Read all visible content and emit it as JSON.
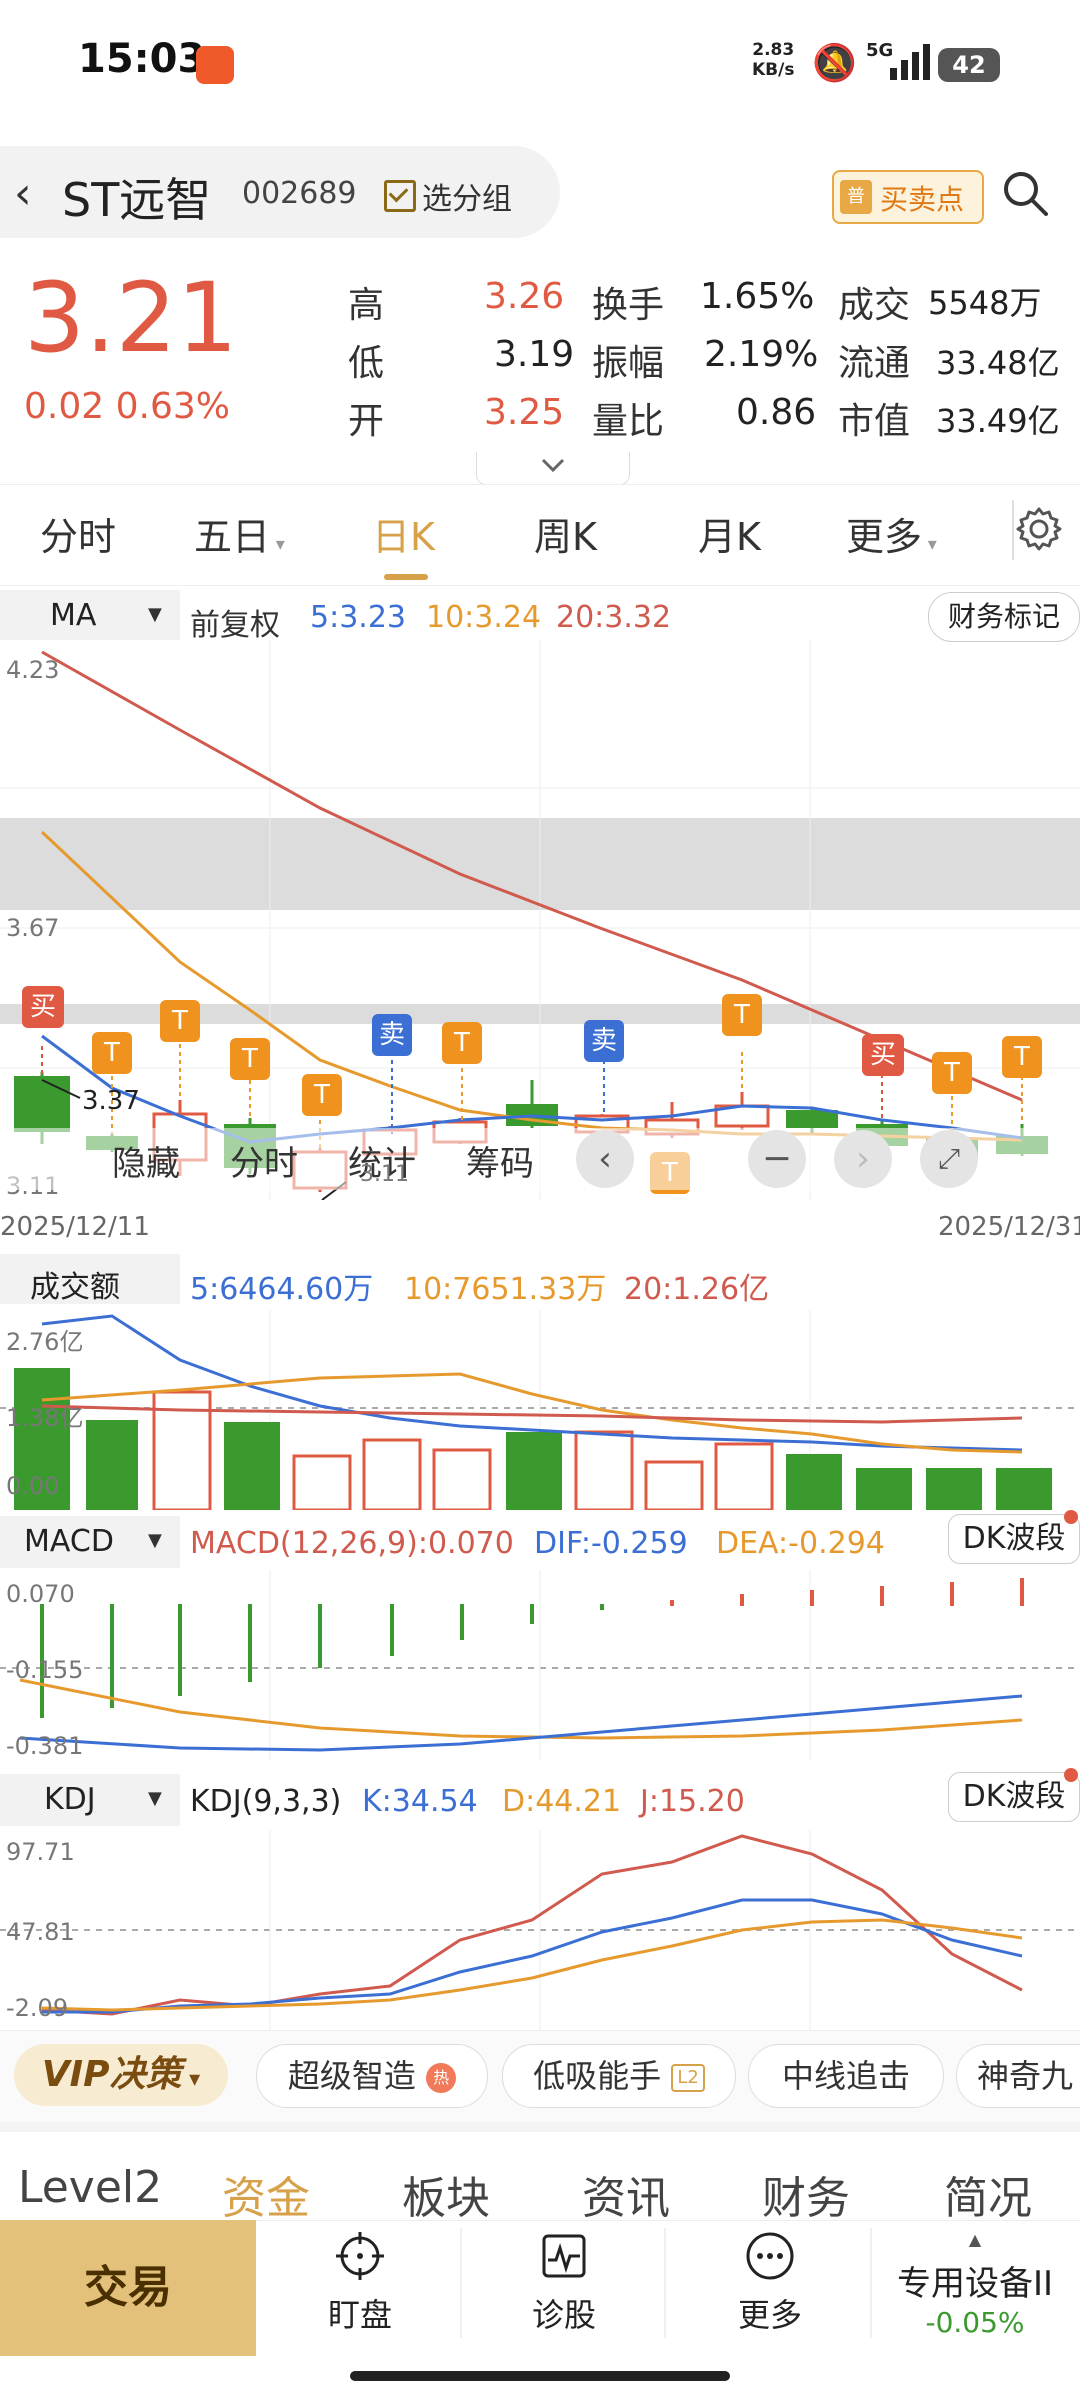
{
  "status": {
    "time": "15:03",
    "net_rate": "2.83",
    "net_unit": "KB/s",
    "network": "5G",
    "battery": "42"
  },
  "stock": {
    "name": "ST远智",
    "code": "002689",
    "watch_label": "选分组",
    "buysell_badge": "普",
    "buysell_label": "买卖点"
  },
  "quote": {
    "price": "3.21",
    "change": "0.02",
    "change_pct": "0.63%",
    "rows": [
      {
        "l1": "高",
        "v1": "3.26",
        "l2": "换手",
        "v2": "1.65%",
        "l3": "成交",
        "v3": "5548万"
      },
      {
        "l1": "低",
        "v1": "3.19",
        "l2": "振幅",
        "v2": "2.19%",
        "l3": "流通",
        "v3": "33.48亿"
      },
      {
        "l1": "开",
        "v1": "3.25",
        "l2": "量比",
        "v2": "0.86",
        "l3": "市值",
        "v3": "33.49亿"
      }
    ]
  },
  "tabs": [
    "分时",
    "五日",
    "日K",
    "周K",
    "月K",
    "更多"
  ],
  "ma": {
    "selector": "MA",
    "adjust": "前复权",
    "ma5": "5:3.23",
    "ma10": "10:3.24",
    "ma20": "20:3.32",
    "fin_button": "财务标记",
    "axis_top": "4.23",
    "axis_mid": "3.67",
    "axis_bot": "3.11",
    "low_marker": "3.37",
    "date_start": "2025/12/11",
    "date_end": "2025/12/31"
  },
  "overlay": {
    "hide": "隐藏",
    "intraday": "分时",
    "stats": "统计",
    "chips": "筹码",
    "mini_label": "3.11"
  },
  "volume": {
    "title": "成交额",
    "ma5": "5:6464.60万",
    "ma10": "10:7651.33万",
    "ma20": "20:1.26亿",
    "axis_top": "2.76亿",
    "axis_mid": "1.38亿",
    "axis_bot": "0.00"
  },
  "macd": {
    "selector": "MACD",
    "title": "MACD(12,26,9):0.070",
    "dif": "DIF:-0.259",
    "dea": "DEA:-0.294",
    "button": "DK波段",
    "axis_top": "0.070",
    "axis_mid": "-0.155",
    "axis_bot": "-0.381"
  },
  "kdj": {
    "selector": "KDJ",
    "title": "KDJ(9,3,3)",
    "k": "K:34.54",
    "d": "D:44.21",
    "j": "J:15.20",
    "button": "DK波段",
    "axis_top": "97.71",
    "axis_mid": "47.81",
    "axis_bot": "-2.09"
  },
  "features": {
    "vip": "VIP决策",
    "items": [
      "超级智造",
      "低吸能手",
      "中线追击",
      "神奇九"
    ],
    "hot_badge": "热",
    "l2_badge": "L2"
  },
  "info_tabs": [
    "Level2",
    "资金",
    "板块",
    "资讯",
    "财务",
    "简况"
  ],
  "bottom": {
    "trade": "交易",
    "watch": "盯盘",
    "diagnose": "诊股",
    "more": "更多",
    "device": "专用设备II",
    "device_pct": "-0.05%"
  },
  "signals": {
    "buy": "买",
    "sell": "卖",
    "t": "T"
  },
  "colors": {
    "up": "#e05a43",
    "down": "#3a9a2e",
    "ma5": "#3b6fd4",
    "ma10": "#e69a2e",
    "ma20": "#d05a4e",
    "accent": "#d7a14a"
  }
}
